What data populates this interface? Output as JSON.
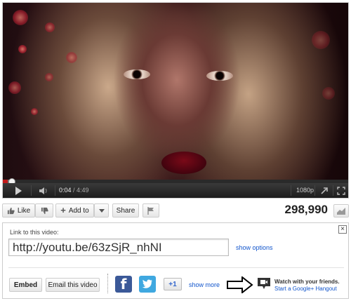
{
  "player": {
    "current_time": "0:04",
    "duration": "/ 4:49",
    "quality": "1080p",
    "progress_fraction": 0.014,
    "buffer_fraction": 0.03
  },
  "actions": {
    "like_label": "Like",
    "add_to_label": "Add to",
    "share_label": "Share",
    "view_count": "298,990"
  },
  "share_panel": {
    "link_label": "Link to this video:",
    "url": "http://youtu.be/63zSjR_nhNI",
    "show_options": "show options",
    "close_symbol": "×",
    "embed_label": "Embed",
    "email_label": "Email this video",
    "show_more": "show more",
    "plusone_label": "+1",
    "hangout_title": "Watch with your friends.",
    "hangout_link": "Start a Google+ Hangout"
  },
  "colors": {
    "link": "#1155cc",
    "progress": "#c21a1a",
    "facebook": "#3b5998",
    "twitter": "#3fa8e0"
  },
  "icons": [
    "play-icon",
    "volume-icon",
    "popout-icon",
    "fullscreen-icon",
    "thumbs-down-icon",
    "plus-icon",
    "chevron-down-icon",
    "flag-icon",
    "stats-icon",
    "close-icon",
    "facebook-icon",
    "twitter-icon",
    "google-plus-one-icon",
    "hangout-icon",
    "arrow-right-icon"
  ]
}
